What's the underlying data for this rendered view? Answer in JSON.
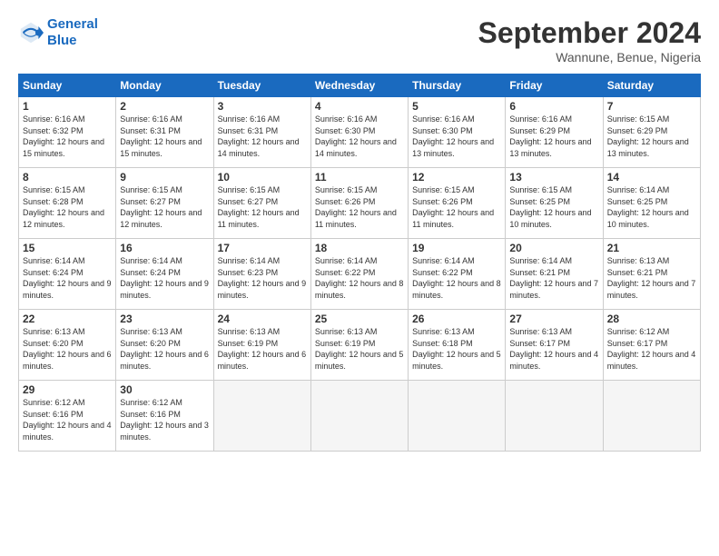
{
  "header": {
    "logo_line1": "General",
    "logo_line2": "Blue",
    "month_year": "September 2024",
    "location": "Wannune, Benue, Nigeria"
  },
  "days_of_week": [
    "Sunday",
    "Monday",
    "Tuesday",
    "Wednesday",
    "Thursday",
    "Friday",
    "Saturday"
  ],
  "weeks": [
    [
      {
        "num": "1",
        "rise": "6:16 AM",
        "set": "6:32 PM",
        "daylight": "12 hours and 15 minutes."
      },
      {
        "num": "2",
        "rise": "6:16 AM",
        "set": "6:31 PM",
        "daylight": "12 hours and 15 minutes."
      },
      {
        "num": "3",
        "rise": "6:16 AM",
        "set": "6:31 PM",
        "daylight": "12 hours and 14 minutes."
      },
      {
        "num": "4",
        "rise": "6:16 AM",
        "set": "6:30 PM",
        "daylight": "12 hours and 14 minutes."
      },
      {
        "num": "5",
        "rise": "6:16 AM",
        "set": "6:30 PM",
        "daylight": "12 hours and 13 minutes."
      },
      {
        "num": "6",
        "rise": "6:16 AM",
        "set": "6:29 PM",
        "daylight": "12 hours and 13 minutes."
      },
      {
        "num": "7",
        "rise": "6:15 AM",
        "set": "6:29 PM",
        "daylight": "12 hours and 13 minutes."
      }
    ],
    [
      {
        "num": "8",
        "rise": "6:15 AM",
        "set": "6:28 PM",
        "daylight": "12 hours and 12 minutes."
      },
      {
        "num": "9",
        "rise": "6:15 AM",
        "set": "6:27 PM",
        "daylight": "12 hours and 12 minutes."
      },
      {
        "num": "10",
        "rise": "6:15 AM",
        "set": "6:27 PM",
        "daylight": "12 hours and 11 minutes."
      },
      {
        "num": "11",
        "rise": "6:15 AM",
        "set": "6:26 PM",
        "daylight": "12 hours and 11 minutes."
      },
      {
        "num": "12",
        "rise": "6:15 AM",
        "set": "6:26 PM",
        "daylight": "12 hours and 11 minutes."
      },
      {
        "num": "13",
        "rise": "6:15 AM",
        "set": "6:25 PM",
        "daylight": "12 hours and 10 minutes."
      },
      {
        "num": "14",
        "rise": "6:14 AM",
        "set": "6:25 PM",
        "daylight": "12 hours and 10 minutes."
      }
    ],
    [
      {
        "num": "15",
        "rise": "6:14 AM",
        "set": "6:24 PM",
        "daylight": "12 hours and 9 minutes."
      },
      {
        "num": "16",
        "rise": "6:14 AM",
        "set": "6:24 PM",
        "daylight": "12 hours and 9 minutes."
      },
      {
        "num": "17",
        "rise": "6:14 AM",
        "set": "6:23 PM",
        "daylight": "12 hours and 9 minutes."
      },
      {
        "num": "18",
        "rise": "6:14 AM",
        "set": "6:22 PM",
        "daylight": "12 hours and 8 minutes."
      },
      {
        "num": "19",
        "rise": "6:14 AM",
        "set": "6:22 PM",
        "daylight": "12 hours and 8 minutes."
      },
      {
        "num": "20",
        "rise": "6:14 AM",
        "set": "6:21 PM",
        "daylight": "12 hours and 7 minutes."
      },
      {
        "num": "21",
        "rise": "6:13 AM",
        "set": "6:21 PM",
        "daylight": "12 hours and 7 minutes."
      }
    ],
    [
      {
        "num": "22",
        "rise": "6:13 AM",
        "set": "6:20 PM",
        "daylight": "12 hours and 6 minutes."
      },
      {
        "num": "23",
        "rise": "6:13 AM",
        "set": "6:20 PM",
        "daylight": "12 hours and 6 minutes."
      },
      {
        "num": "24",
        "rise": "6:13 AM",
        "set": "6:19 PM",
        "daylight": "12 hours and 6 minutes."
      },
      {
        "num": "25",
        "rise": "6:13 AM",
        "set": "6:19 PM",
        "daylight": "12 hours and 5 minutes."
      },
      {
        "num": "26",
        "rise": "6:13 AM",
        "set": "6:18 PM",
        "daylight": "12 hours and 5 minutes."
      },
      {
        "num": "27",
        "rise": "6:13 AM",
        "set": "6:17 PM",
        "daylight": "12 hours and 4 minutes."
      },
      {
        "num": "28",
        "rise": "6:12 AM",
        "set": "6:17 PM",
        "daylight": "12 hours and 4 minutes."
      }
    ],
    [
      {
        "num": "29",
        "rise": "6:12 AM",
        "set": "6:16 PM",
        "daylight": "12 hours and 4 minutes."
      },
      {
        "num": "30",
        "rise": "6:12 AM",
        "set": "6:16 PM",
        "daylight": "12 hours and 3 minutes."
      },
      null,
      null,
      null,
      null,
      null
    ]
  ]
}
